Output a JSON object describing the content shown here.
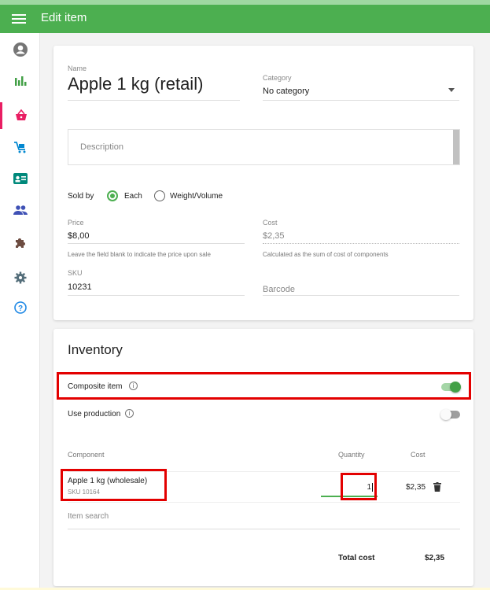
{
  "header": {
    "title": "Edit item"
  },
  "sidebar": {
    "icons": [
      "account-circle-icon",
      "bar-chart-icon",
      "basket-icon",
      "cart-icon",
      "customer-card-icon",
      "people-icon",
      "puzzle-icon",
      "gear-icon",
      "help-icon"
    ]
  },
  "item": {
    "name_label": "Name",
    "name": "Apple 1 kg (retail)",
    "category_label": "Category",
    "category": "No category",
    "description_placeholder": "Description",
    "sold_by_label": "Sold by",
    "sold_by_options": [
      "Each",
      "Weight/Volume"
    ],
    "price_label": "Price",
    "price": "$8,00",
    "price_hint": "Leave the field blank to indicate the price upon sale",
    "cost_label": "Cost",
    "cost": "$2,35",
    "cost_hint": "Calculated as the sum of cost of components",
    "sku_label": "SKU",
    "sku": "10231",
    "barcode_placeholder": "Barcode"
  },
  "inventory": {
    "title": "Inventory",
    "composite_label": "Composite item",
    "composite_on": true,
    "production_label": "Use production",
    "production_on": false,
    "col_component": "Component",
    "col_quantity": "Quantity",
    "col_cost": "Cost",
    "component_name": "Apple 1 kg (wholesale)",
    "component_sku": "SKU 10164",
    "component_quantity": "1",
    "component_cost": "$2,35",
    "search_placeholder": "Item search",
    "total_label": "Total cost",
    "total_value": "$2,35"
  },
  "colors": {
    "green": "#4caf50",
    "pink": "#e91e63",
    "red": "#e30000"
  }
}
